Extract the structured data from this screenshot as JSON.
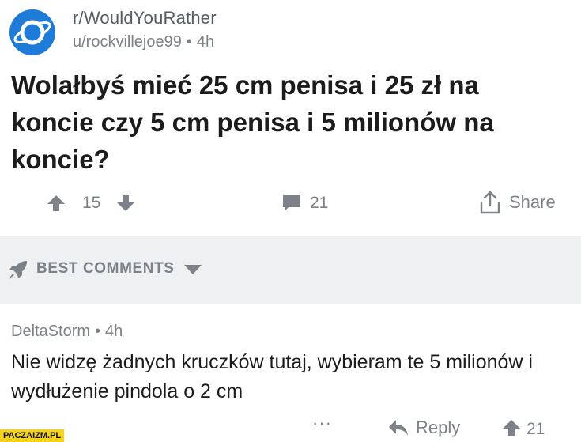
{
  "post": {
    "subreddit": "r/WouldYouRather",
    "author": "u/rockvillejoe99",
    "separator": "•",
    "age": "4h",
    "title": "Wolałbyś mieć 25 cm penisa i 25 zł na koncie czy 5 cm penisa i 5 milionów na koncie?",
    "score": "15",
    "comment_count": "21",
    "share_label": "Share"
  },
  "sort": {
    "label": "BEST COMMENTS"
  },
  "comment": {
    "author": "DeltaStorm",
    "separator": "•",
    "age": "4h",
    "body": "Nie widzę żadnych kruczków tutaj, wybieram te 5 milionów i wydłużenie pindola o 2 cm",
    "more_label": "···",
    "reply_label": "Reply",
    "score": "21"
  },
  "watermark": "PACZAIZM.PL",
  "colors": {
    "subreddit_icon": "#1f7bd8",
    "muted_text": "#7c8288",
    "sort_bar_bg": "#eef0f2",
    "watermark_bg": "#f6d21b"
  },
  "icons": [
    "planet-icon",
    "upvote-icon",
    "downvote-icon",
    "comment-bubble-icon",
    "share-icon",
    "rocket-icon",
    "chevron-down-icon",
    "reply-arrow-icon"
  ]
}
